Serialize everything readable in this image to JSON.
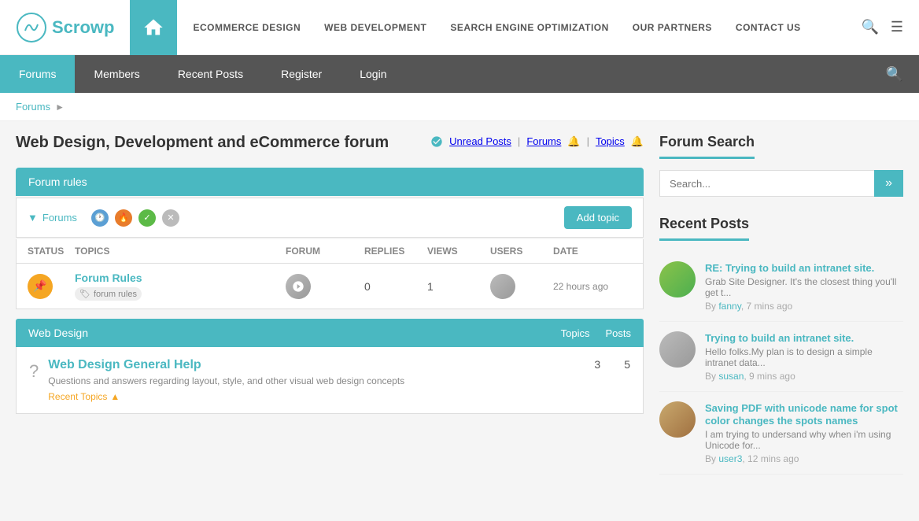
{
  "site": {
    "logo_text": "Scrowp",
    "nav_items": [
      {
        "label": "ECOMMERCE DESIGN",
        "href": "#"
      },
      {
        "label": "WEB DEVELOPMENT",
        "href": "#"
      },
      {
        "label": "SEARCH ENGINE OPTIMIZATION",
        "href": "#"
      },
      {
        "label": "OUR PARTNERS",
        "href": "#"
      },
      {
        "label": "CONTACT US",
        "href": "#"
      }
    ]
  },
  "secondary_nav": {
    "items": [
      {
        "label": "Forums",
        "active": true
      },
      {
        "label": "Members",
        "active": false
      },
      {
        "label": "Recent Posts",
        "active": false
      },
      {
        "label": "Register",
        "active": false
      },
      {
        "label": "Login",
        "active": false
      }
    ]
  },
  "breadcrumb": {
    "items": [
      {
        "label": "Forums",
        "href": "#"
      }
    ]
  },
  "forum": {
    "title": "Web Design, Development and eCommerce forum",
    "meta": {
      "unread_posts": "Unread Posts",
      "forums": "Forums",
      "topics": "Topics"
    },
    "rules_label": "Forum rules",
    "filters_label": "Forums",
    "add_topic_label": "Add topic",
    "table_headers": {
      "status": "Status",
      "topics": "Topics",
      "forum": "Forum",
      "replies": "Replies",
      "views": "Views",
      "users": "Users",
      "date": "Date"
    },
    "rows": [
      {
        "title": "Forum Rules",
        "tag": "forum rules",
        "replies": "0",
        "views": "1",
        "date": "22 hours ago"
      }
    ],
    "sections": [
      {
        "label": "Web Design",
        "topics_label": "Topics",
        "posts_label": "Posts",
        "categories": [
          {
            "title": "Web Design General Help",
            "description": "Questions and answers regarding layout, style, and other visual web design concepts",
            "topics": "3",
            "posts": "5",
            "recent_topics_label": "Recent Topics"
          }
        ]
      }
    ]
  },
  "sidebar": {
    "search": {
      "title": "Forum Search",
      "placeholder": "Search...",
      "button_label": "»"
    },
    "recent_posts": {
      "title": "Recent Posts",
      "items": [
        {
          "title": "RE: Trying to build an intranet site.",
          "excerpt": "Grab Site Designer. It's the closest thing you'll get t...",
          "author": "fanny",
          "time": "7 mins ago"
        },
        {
          "title": "Trying to build an intranet site.",
          "excerpt": "Hello folks.My plan is to design a simple intranet data...",
          "author": "susan",
          "time": "9 mins ago"
        },
        {
          "title": "Saving PDF with unicode name for spot color changes the spots names",
          "excerpt": "I am trying to undersand why when i'm using Unicode for...",
          "author": "user3",
          "time": "12 mins ago"
        }
      ]
    }
  }
}
